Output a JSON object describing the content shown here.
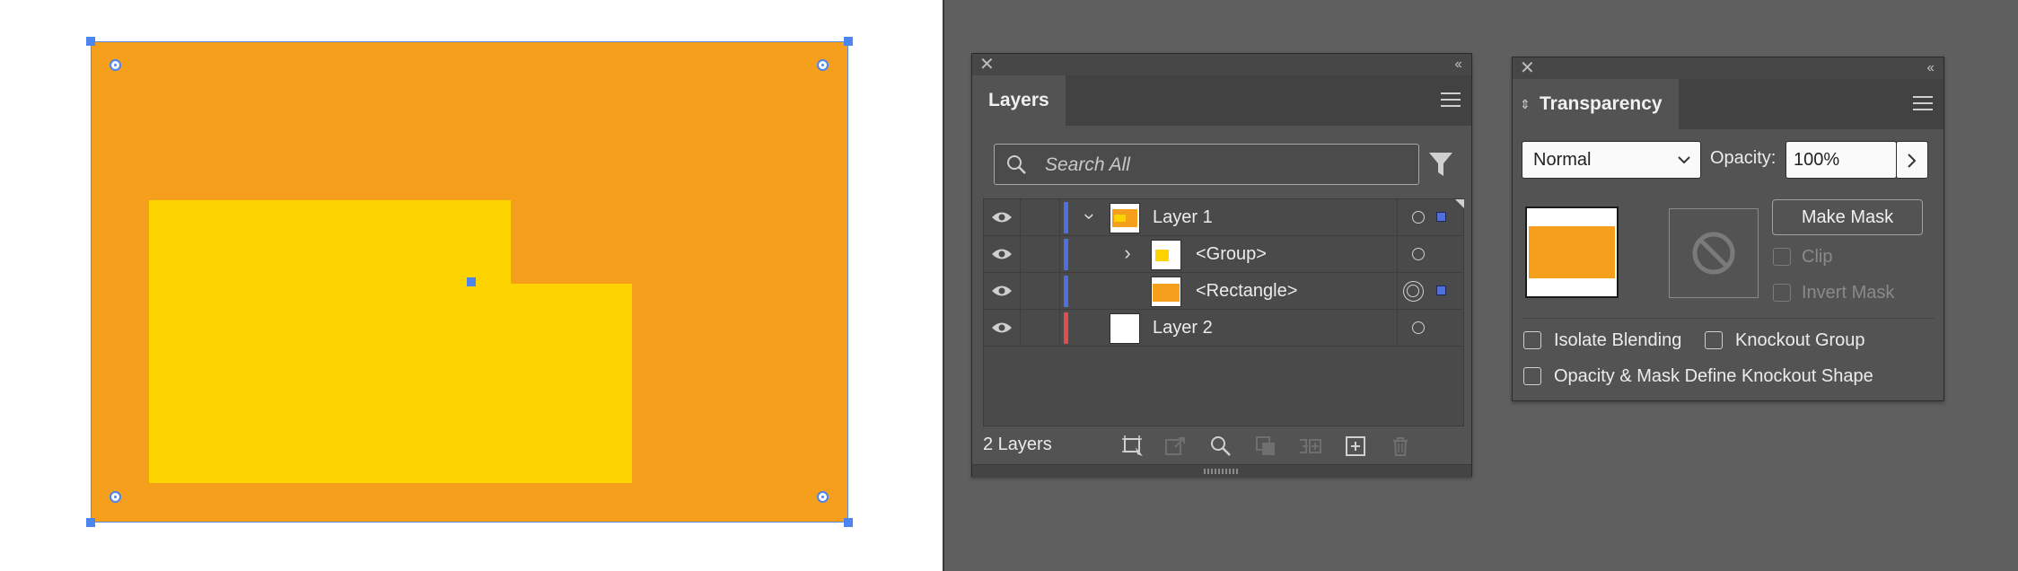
{
  "layers_panel": {
    "tab_title": "Layers",
    "search_placeholder": "Search All",
    "rows": [
      {
        "name": "Layer 1",
        "color": "#4d6fe0"
      },
      {
        "name": "<Group>",
        "color": "#4d6fe0"
      },
      {
        "name": "<Rectangle>",
        "color": "#4d6fe0"
      },
      {
        "name": "Layer 2",
        "color": "#e04d4d"
      }
    ],
    "footer_count": "2 Layers"
  },
  "transparency_panel": {
    "tab_title": "Transparency",
    "blend_mode": "Normal",
    "opacity_label": "Opacity:",
    "opacity_value": "100%",
    "make_mask_label": "Make Mask",
    "clip_label": "Clip",
    "invert_mask_label": "Invert Mask",
    "isolate_blending_label": "Isolate Blending",
    "knockout_group_label": "Knockout Group",
    "opacity_mask_define_label": "Opacity & Mask Define Knockout Shape"
  },
  "colors": {
    "artboard_orange": "#f69f1c",
    "shape_yellow": "#fdd400",
    "selection_blue": "#4d85f0"
  }
}
